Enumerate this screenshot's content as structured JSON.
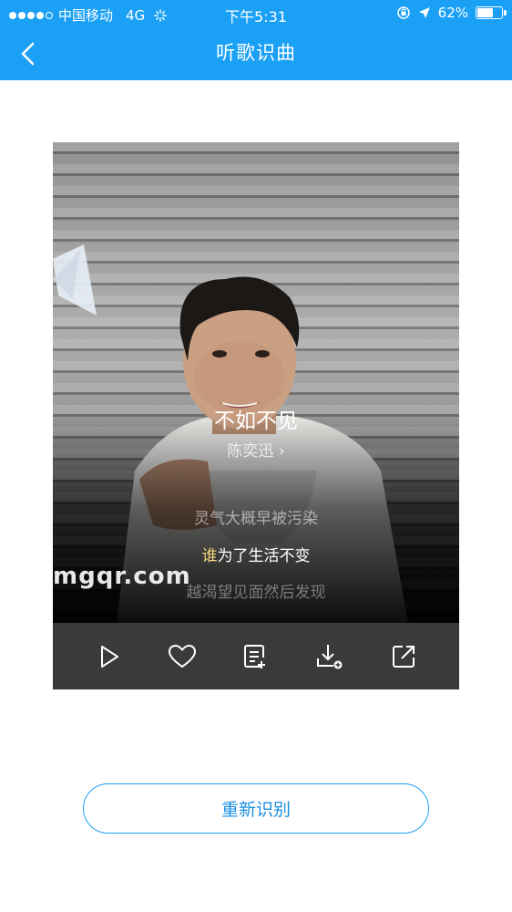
{
  "status_bar": {
    "carrier": "中国移动",
    "network": "4G",
    "time": "下午5:31",
    "battery": "62%",
    "battery_level": 0.62,
    "signal_bars": 4
  },
  "nav": {
    "title": "听歌识曲"
  },
  "result": {
    "song_title": "不如不见",
    "artist": "陈奕迅 ›",
    "lyrics": {
      "line1": "灵气大概早被污染",
      "line2_highlight": "谁",
      "line2_rest": "为了生活不变",
      "line3": "越渴望见面然后发现"
    }
  },
  "watermark": "mgqr.com",
  "controls": {
    "icons": [
      "play-icon",
      "heart-icon",
      "add-to-playlist-icon",
      "download-icon",
      "share-icon"
    ]
  },
  "actions": {
    "retry_label": "重新识别"
  },
  "colors": {
    "accent": "#1aa0f5",
    "highlight": "#f5d57a",
    "control_bar": "#3a3a3a"
  }
}
